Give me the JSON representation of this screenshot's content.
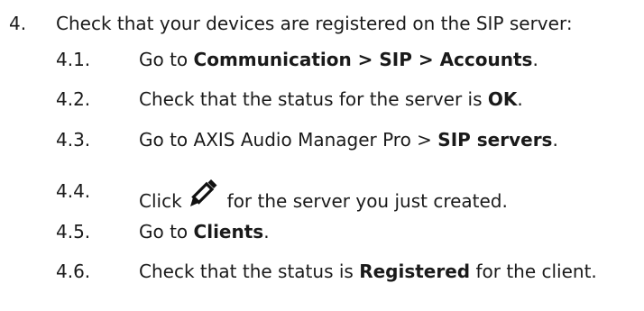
{
  "step": {
    "number": "4.",
    "text": "Check that your devices are registered on the SIP server:"
  },
  "substeps": [
    {
      "number": "4.1.",
      "pre": "Go to ",
      "bold": "Communication > SIP > Accounts",
      "post": "."
    },
    {
      "number": "4.2.",
      "pre": "Check that the status for the server is ",
      "bold": "OK",
      "post": "."
    },
    {
      "number": "4.3.",
      "pre": "Go to AXIS Audio Manager Pro > ",
      "bold": "SIP servers",
      "post": "."
    },
    {
      "number": "4.4.",
      "pre": "Click",
      "icon": "pencil-edit-icon",
      "post": "for the server you just created."
    },
    {
      "number": "4.5.",
      "pre": "Go to ",
      "bold": "Clients",
      "post": "."
    },
    {
      "number": "4.6.",
      "pre": "Check that the status is ",
      "bold": "Registered",
      "post": " for the client."
    }
  ]
}
